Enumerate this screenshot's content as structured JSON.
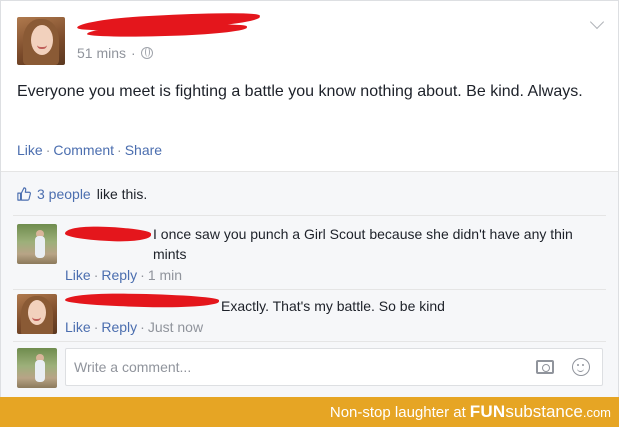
{
  "post": {
    "timestamp": "51 mins",
    "text": "Everyone you meet is fighting a battle you know nothing about. Be kind. Always.",
    "actions": {
      "like": "Like",
      "comment": "Comment",
      "share": "Share"
    }
  },
  "likes": {
    "count_link": "3 people",
    "suffix": "like this."
  },
  "comments": [
    {
      "text": "I once saw you punch a Girl Scout because she didn't have any thin mints",
      "like": "Like",
      "reply": "Reply",
      "time": "1 min"
    },
    {
      "text": "Exactly. That's my battle. So be kind",
      "like": "Like",
      "reply": "Reply",
      "time": "Just now"
    }
  ],
  "composer": {
    "placeholder": "Write a comment..."
  },
  "footer": {
    "prefix": "Non-stop laughter at",
    "brand_bold": "FUN",
    "brand_light": "substance",
    "brand_tld": ".com"
  },
  "colors": {
    "link": "#4b6eaf",
    "redaction": "#e4161c",
    "footer_bg": "#e6a524"
  }
}
